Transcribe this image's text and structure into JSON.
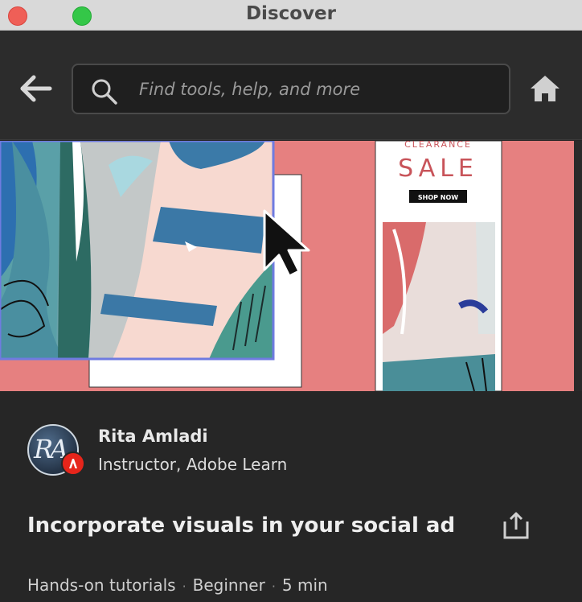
{
  "window": {
    "title": "Discover"
  },
  "search": {
    "placeholder": "Find tools, help, and more"
  },
  "hero": {
    "ad_headline": "SALE",
    "ad_top_text": "CLEARANCE",
    "ad_button": "SHOP NOW"
  },
  "author": {
    "name": "Rita Amladi",
    "role": "Instructor, Adobe Learn",
    "monogram": "RA"
  },
  "course": {
    "title": "Incorporate visuals in your social ad",
    "category": "Hands-on tutorials",
    "level": "Beginner",
    "duration": "5 min"
  },
  "colors": {
    "hero_bg": "#e68080",
    "adobe_red": "#e6251b",
    "panel_bg": "#262626"
  }
}
